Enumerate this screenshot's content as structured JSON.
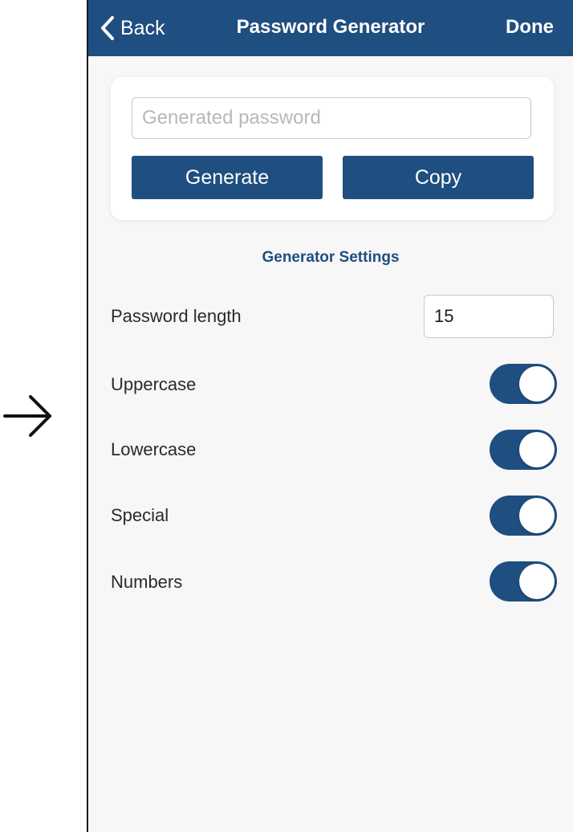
{
  "nav": {
    "back_label": "Back",
    "title": "Password Generator",
    "done_label": "Done"
  },
  "generator": {
    "password_placeholder": "Generated password",
    "password_value": "",
    "generate_label": "Generate",
    "copy_label": "Copy"
  },
  "settings": {
    "section_title": "Generator Settings",
    "length_label": "Password length",
    "length_value": "15",
    "options": [
      {
        "label": "Uppercase",
        "enabled": true
      },
      {
        "label": "Lowercase",
        "enabled": true
      },
      {
        "label": "Special",
        "enabled": true
      },
      {
        "label": "Numbers",
        "enabled": true
      }
    ]
  },
  "colors": {
    "accent": "#1f4e80",
    "background": "#f7f7f7",
    "card": "#ffffff"
  },
  "icons": {
    "back": "chevron-left-icon",
    "side": "arrow-right-icon",
    "toggle": "toggle-switch"
  }
}
